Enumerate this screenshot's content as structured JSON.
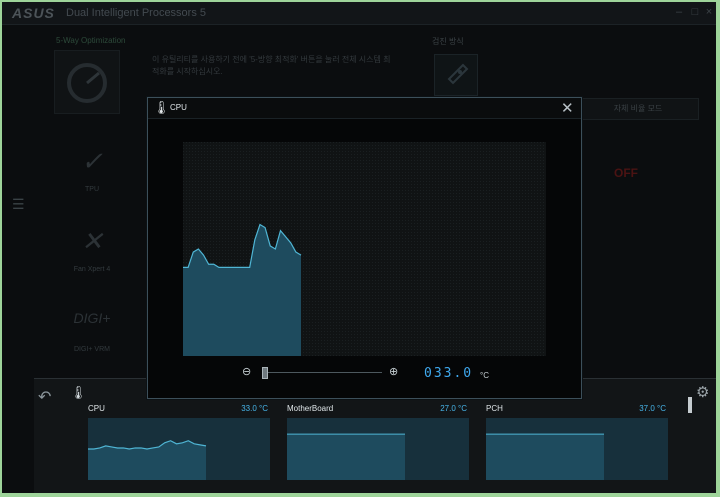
{
  "app": {
    "logo": "ASUS",
    "title": "Dual Intelligent Processors 5",
    "controls": {
      "minimize": "–",
      "maximize": "□",
      "close": "×"
    }
  },
  "background": {
    "section_label": "5-Way Optimization",
    "description": "이 유틸리티를 사용하기 전에 '5-방향 최적화' 버튼을 눌러 전체 시스템 최적화를 시작하십시오.",
    "right_label": "검진 방식",
    "auto_button": "자체 비율 모드",
    "off_text": "OFF",
    "side_items": [
      {
        "label": "TPU"
      },
      {
        "label": "Fan Xpert 4"
      },
      {
        "label": "DIGI+ VRM"
      }
    ]
  },
  "popup": {
    "title": "CPU",
    "readout": "033.0",
    "unit": "°C",
    "zoom_level": 0.0,
    "series": [
      29,
      29,
      34,
      35,
      33,
      30,
      30,
      29,
      29,
      29,
      29,
      29,
      29,
      29,
      38,
      43,
      42,
      36,
      35,
      41,
      39,
      37,
      34,
      33
    ]
  },
  "monitors": [
    {
      "label": "CPU",
      "value": "33.0 °C",
      "series": [
        30,
        30,
        31,
        33,
        32,
        31,
        31,
        30,
        31,
        31,
        30,
        31,
        32,
        36,
        38,
        35,
        36,
        38,
        35,
        34,
        33
      ],
      "kind": "line"
    },
    {
      "label": "MotherBoard",
      "value": "27.0 °C",
      "kind": "flat",
      "level": 0.74
    },
    {
      "label": "PCH",
      "value": "37.0 °C",
      "kind": "flat",
      "level": 0.74
    }
  ],
  "colors": {
    "accent": "#3fa9ef",
    "graph_fill": "#1e4b5e",
    "graph_line": "#4fb5d4",
    "off": "#4b1313"
  },
  "icons": {
    "thermometer": "thermometer-icon",
    "close": "close-icon",
    "zoom_out": "zoom-out-icon",
    "zoom_in": "zoom-in-icon",
    "undo": "undo-icon",
    "settings": "gear-icon",
    "menu": "hamburger-icon"
  }
}
